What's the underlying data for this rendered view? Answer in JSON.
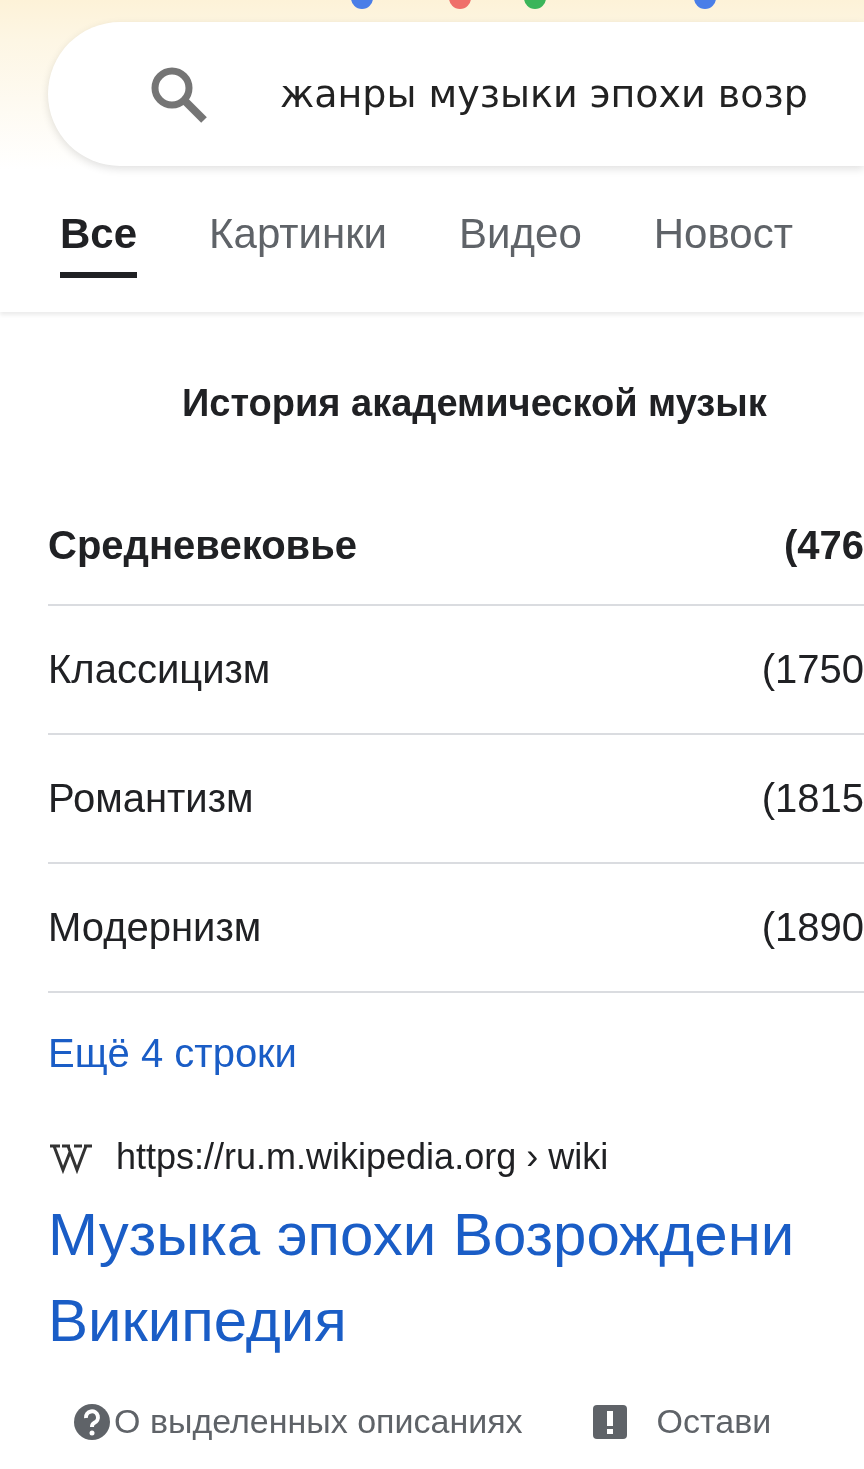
{
  "search": {
    "value": "жанры музыки эпохи возр"
  },
  "tabs": [
    {
      "label": "Все",
      "selected": true
    },
    {
      "label": "Картинки",
      "selected": false
    },
    {
      "label": "Видео",
      "selected": false
    },
    {
      "label": "Новост",
      "selected": false
    }
  ],
  "table": {
    "title": "История академической музык",
    "rows": [
      {
        "name": "Средневековье",
        "period": "(476",
        "highlighted": true
      },
      {
        "name": "Классицизм",
        "period": "(1750",
        "highlighted": false
      },
      {
        "name": "Романтизм",
        "period": "(1815",
        "highlighted": false
      },
      {
        "name": "Модернизм",
        "period": "(1890",
        "highlighted": false
      }
    ],
    "more_link": "Ещё 4 строки"
  },
  "result": {
    "url": "https://ru.m.wikipedia.org › wiki",
    "title_lines": [
      "Музыка эпохи Возрождени",
      "Википедия"
    ]
  },
  "footer": {
    "about": "О выделенных описаниях",
    "feedback": "Остави"
  }
}
